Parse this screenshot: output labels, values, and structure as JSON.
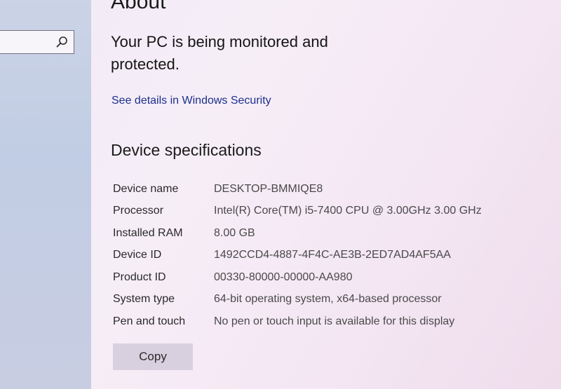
{
  "search": {
    "icon": "search-icon"
  },
  "page": {
    "title": "About",
    "protection_status": "Your PC is being monitored and protected.",
    "security_link": "See details in Windows Security"
  },
  "device_specifications": {
    "heading": "Device specifications",
    "rows": [
      {
        "label": "Device name",
        "value": "DESKTOP-BMMIQE8"
      },
      {
        "label": "Processor",
        "value": "Intel(R) Core(TM) i5-7400 CPU @ 3.00GHz   3.00 GHz"
      },
      {
        "label": "Installed RAM",
        "value": "8.00 GB"
      },
      {
        "label": "Device ID",
        "value": "1492CCD4-4887-4F4C-AE3B-2ED7AD4AF5AA"
      },
      {
        "label": "Product ID",
        "value": "00330-80000-00000-AA980"
      },
      {
        "label": "System type",
        "value": "64-bit operating system, x64-based processor"
      },
      {
        "label": "Pen and touch",
        "value": "No pen or touch input is available for this display"
      }
    ],
    "copy_label": "Copy"
  }
}
